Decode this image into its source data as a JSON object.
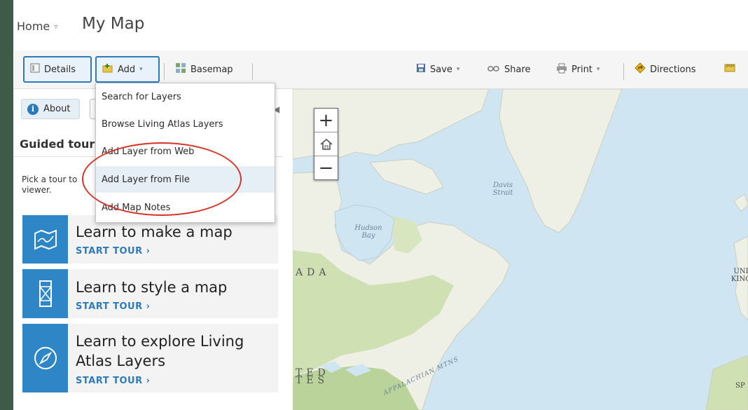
{
  "header": {
    "home_label": "Home",
    "home_caret": "▿",
    "map_title": "My Map"
  },
  "toolbar": {
    "details": "Details",
    "add": "Add",
    "basemap": "Basemap",
    "save": "Save",
    "share": "Share",
    "print": "Print",
    "directions": "Directions"
  },
  "add_menu": {
    "items": [
      "Search for Layers",
      "Browse Living Atlas Layers",
      "Add Layer from Web",
      "Add Layer from File",
      "Add Map Notes"
    ],
    "highlighted_index": 3
  },
  "panel": {
    "about": "About",
    "guided_tours_title": "Guided tour",
    "pick_text": "Pick a tour to viewer.",
    "tours": [
      {
        "title": "Learn to make a map",
        "link": "START TOUR ›",
        "icon": "map-icon"
      },
      {
        "title": "Learn to style a map",
        "link": "START TOUR ›",
        "icon": "style-icon"
      },
      {
        "title": "Learn to explore Living Atlas Layers",
        "link": "START TOUR ›",
        "icon": "compass-icon"
      }
    ]
  },
  "map": {
    "zoom_in": "+",
    "home_icon": "home-icon",
    "zoom_out": "−",
    "labels": {
      "davis": "Davis Strait",
      "hudson": "Hudson Bay",
      "canada": "ADA",
      "united_states": "TED TES",
      "appalachian": "APPALACHIAN MTNS",
      "uk": "UNI KING",
      "sp": "SP"
    }
  },
  "colors": {
    "accent": "#2f86c6",
    "highlight_ring": "#d63429",
    "water": "#cfe6f2",
    "land": "#eef0e6"
  }
}
